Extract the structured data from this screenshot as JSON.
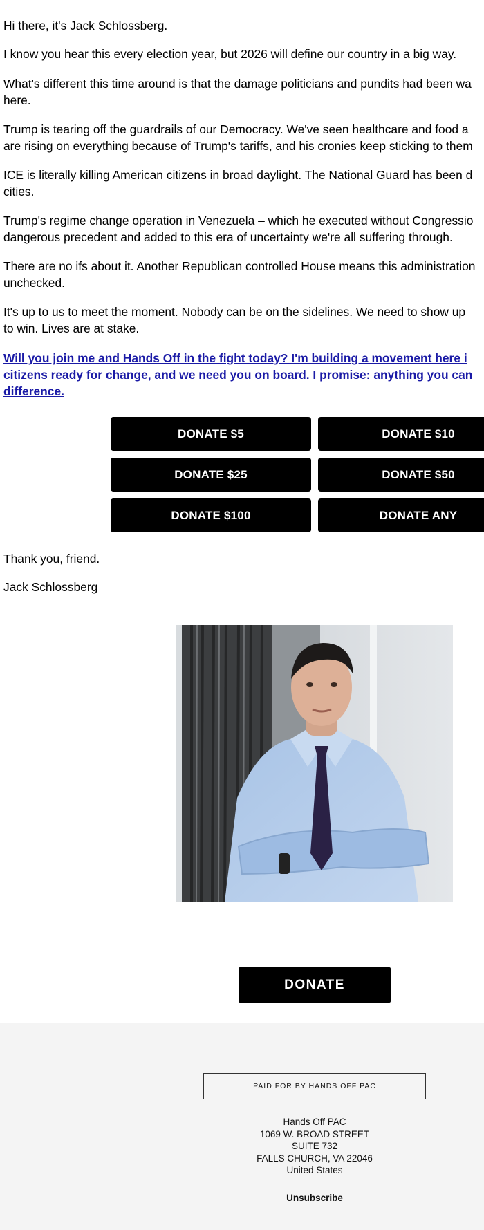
{
  "letter": {
    "greeting": "Hi there, it's Jack Schlossberg.",
    "p1": "I know you hear this every election year, but 2026 will define our country in a big way.",
    "p2_l1": "What's different this time around is that the damage politicians and pundits had been wa",
    "p2_l2": "here.",
    "p3_l1": "Trump is tearing off the guardrails of our Democracy. We've seen healthcare and food a",
    "p3_l2": "are rising on everything because of Trump's tariffs, and his cronies keep sticking to them",
    "p4_l1": "ICE is literally killing American citizens in broad daylight. The National Guard has been d",
    "p4_l2": "cities.",
    "p5_l1": "Trump's regime change operation in Venezuela – which he executed without Congressio",
    "p5_l2": "dangerous precedent and added to this era of uncertainty we're all suffering through.",
    "p6_l1": "There are no ifs about it. Another Republican controlled House means this administration",
    "p6_l2": "unchecked.",
    "p7_l1": "It's up to us to meet the moment. Nobody can be on the sidelines. We need to show up",
    "p7_l2": "to win. Lives are at stake.",
    "cta_l1": "Will you join me and Hands Off in the fight today? I'm building a movement here i",
    "cta_l2": "citizens ready for change, and we need you on board. I promise: anything you can",
    "cta_l3": "difference.",
    "thanks": "Thank you, friend.",
    "signature": "Jack Schlossberg"
  },
  "donate_buttons": {
    "b5": "DONATE $5",
    "b10": "DONATE $10",
    "b25": "DONATE $25",
    "b50": "DONATE $50",
    "b100": "DONATE $100",
    "bany": "DONATE ANY"
  },
  "main_donate": "DONATE",
  "footer": {
    "paid_for": "PAID FOR BY HANDS OFF PAC",
    "org": "Hands Off PAC",
    "street": "1069 W. BROAD STREET",
    "suite": "SUITE 732",
    "city": "FALLS CHURCH, VA 22046",
    "country": "United States",
    "unsubscribe": "Unsubscribe"
  },
  "colors": {
    "link": "#1a1aa6",
    "button_bg": "#000000",
    "footer_bg": "#f4f4f4"
  }
}
